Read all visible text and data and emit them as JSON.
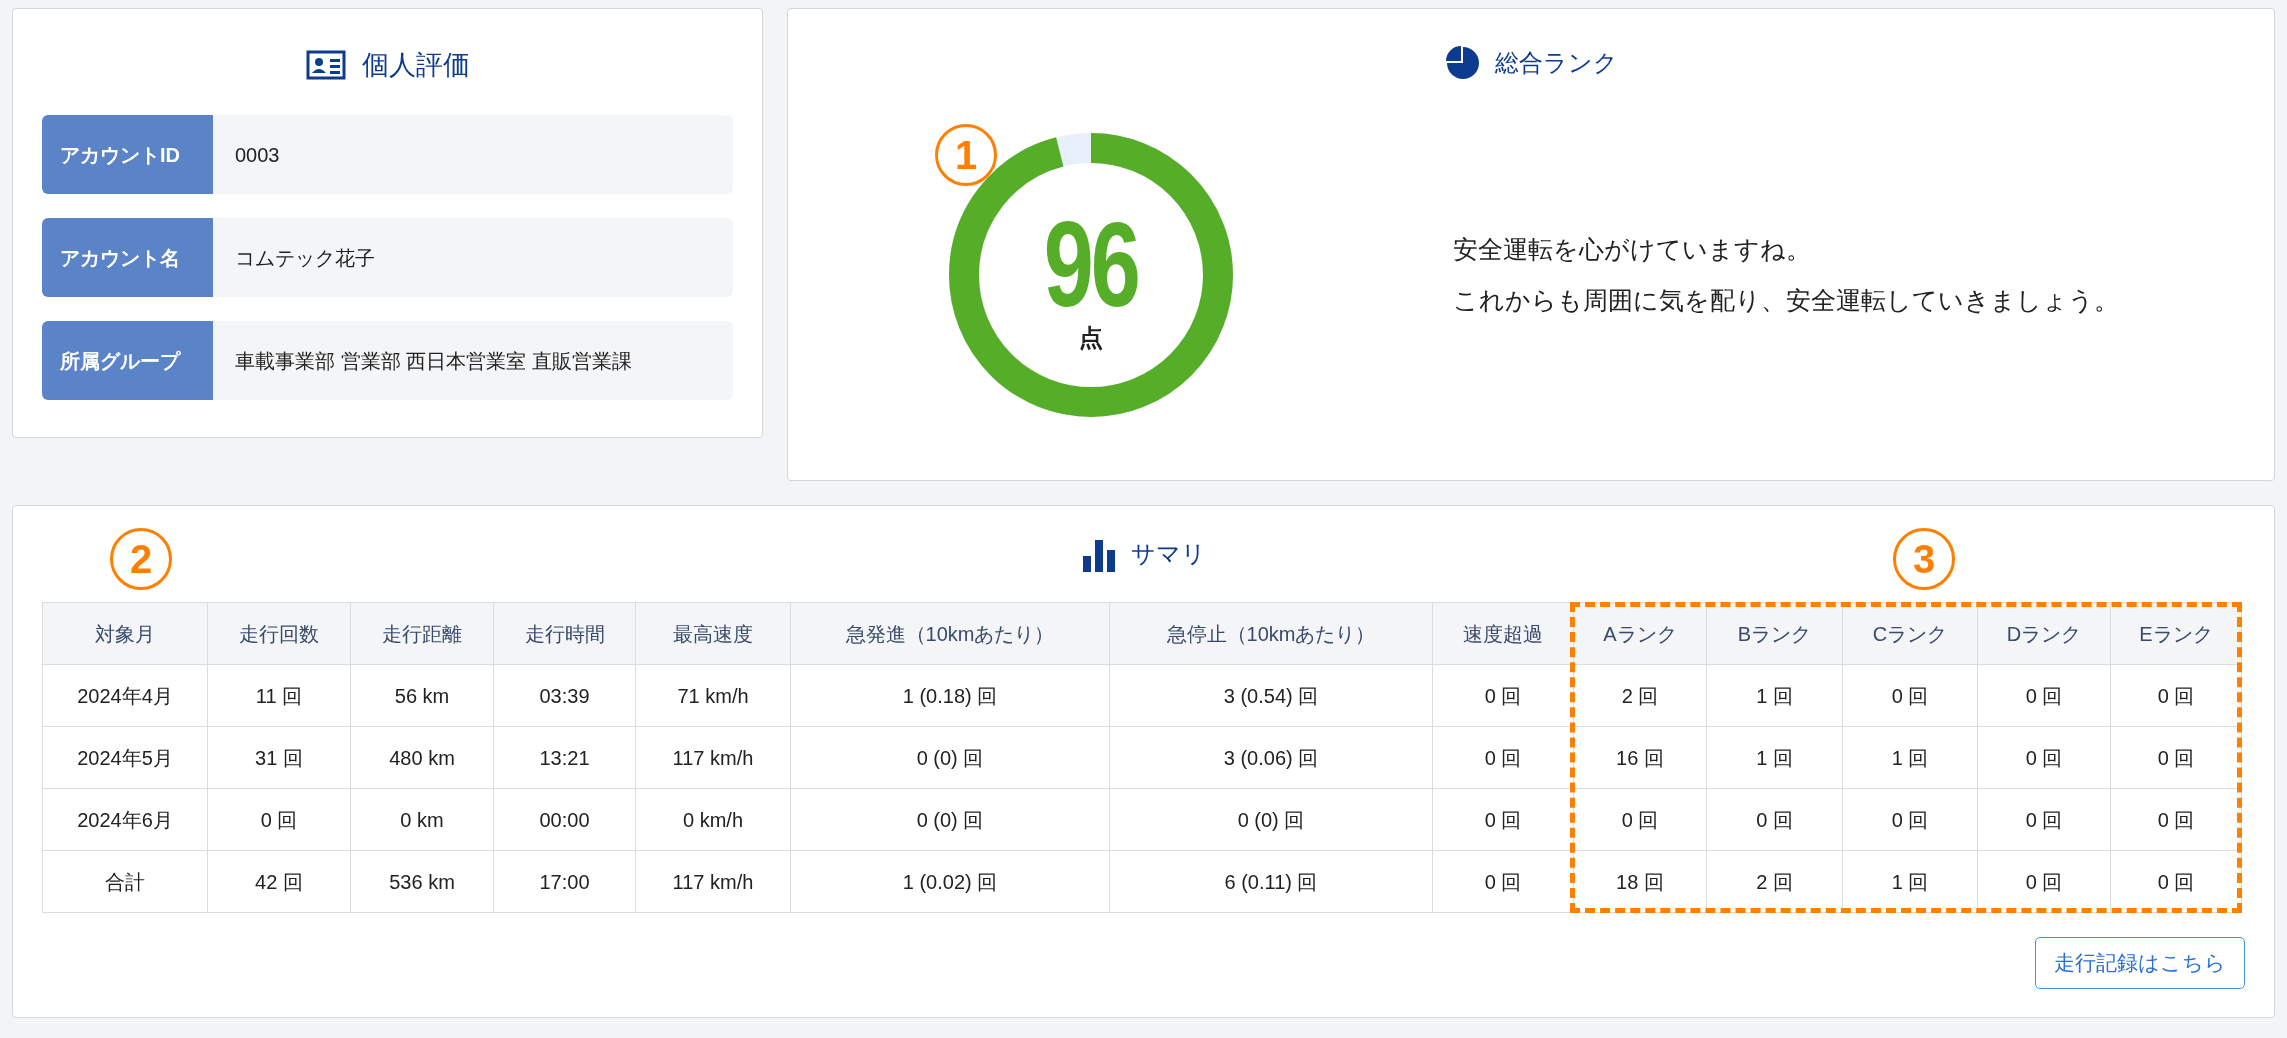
{
  "profile": {
    "title": "個人評価",
    "fields": [
      {
        "label": "アカウントID",
        "value": "0003"
      },
      {
        "label": "アカウント名",
        "value": "コムテック花子"
      },
      {
        "label": "所属グループ",
        "value": "車載事業部 営業部 西日本営業室 直販営業課"
      }
    ]
  },
  "rank": {
    "title": "総合ランク",
    "score": "96",
    "unit": "点",
    "level": 0.96,
    "messages": [
      "安全運転を心がけていますね。",
      "これからも周囲に気を配り、安全運転していきましょう。"
    ]
  },
  "summary": {
    "title": "サマリ",
    "columns": [
      {
        "label": "対象月",
        "highlighted": false
      },
      {
        "label": "走行回数",
        "highlighted": false
      },
      {
        "label": "走行距離",
        "highlighted": false
      },
      {
        "label": "走行時間",
        "highlighted": false
      },
      {
        "label": "最高速度",
        "highlighted": false
      },
      {
        "label": "急発進（10kmあたり）",
        "highlighted": false
      },
      {
        "label": "急停止（10kmあたり）",
        "highlighted": false
      },
      {
        "label": "速度超過",
        "highlighted": false
      },
      {
        "label": "Aランク",
        "highlighted": true
      },
      {
        "label": "Bランク",
        "highlighted": true
      },
      {
        "label": "Cランク",
        "highlighted": true
      },
      {
        "label": "Dランク",
        "highlighted": true
      },
      {
        "label": "Eランク",
        "highlighted": true
      }
    ],
    "rows": [
      [
        "2024年4月",
        "11 回",
        "56 km",
        "03:39",
        "71 km/h",
        "1 (0.18) 回",
        "3 (0.54) 回",
        "0 回",
        "2 回",
        "1 回",
        "0 回",
        "0 回",
        "0 回"
      ],
      [
        "2024年5月",
        "31 回",
        "480 km",
        "13:21",
        "117 km/h",
        "0 (0) 回",
        "3 (0.06) 回",
        "0 回",
        "16 回",
        "1 回",
        "1 回",
        "0 回",
        "0 回"
      ],
      [
        "2024年6月",
        "0 回",
        "0 km",
        "00:00",
        "0 km/h",
        "0 (0) 回",
        "0 (0) 回",
        "0 回",
        "0 回",
        "0 回",
        "0 回",
        "0 回",
        "0 回"
      ],
      [
        "合計",
        "42 回",
        "536 km",
        "17:00",
        "117 km/h",
        "1 (0.02) 回",
        "6 (0.11) 回",
        "0 回",
        "18 回",
        "2 回",
        "1 回",
        "0 回",
        "0 回"
      ]
    ],
    "button": "走行記録はこちら"
  },
  "callouts": [
    {
      "label": "1"
    },
    {
      "label": "2"
    },
    {
      "label": "3"
    }
  ]
}
